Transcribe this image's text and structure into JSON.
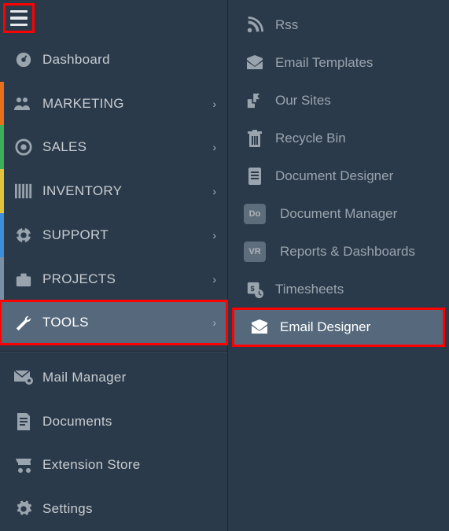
{
  "left": {
    "dashboard": "Dashboard",
    "marketing": "MARKETING",
    "sales": "SALES",
    "inventory": "INVENTORY",
    "support": "SUPPORT",
    "projects": "PROJECTS",
    "tools": "TOOLS",
    "mail_manager": "Mail Manager",
    "documents": "Documents",
    "extension_store": "Extension Store",
    "settings": "Settings"
  },
  "right": {
    "rss": "Rss",
    "email_templates": "Email Templates",
    "our_sites": "Our Sites",
    "recycle_bin": "Recycle Bin",
    "document_designer": "Document Designer",
    "document_manager": "Document Manager",
    "reports_dashboards": "Reports & Dashboards",
    "timesheets": "Timesheets",
    "email_designer": "Email Designer",
    "badge_do": "Do",
    "badge_vr": "VR"
  },
  "accents": {
    "marketing": "#e8701a",
    "sales": "#3fae5a",
    "inventory": "#e3c23b",
    "support": "#3a8fd8",
    "projects": "#7a8fa5"
  }
}
